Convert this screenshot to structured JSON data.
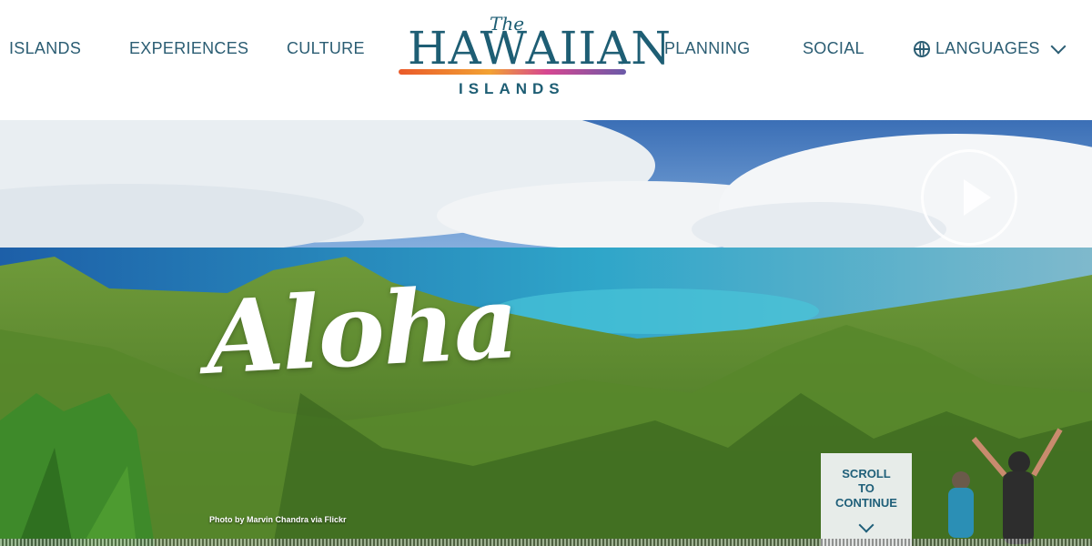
{
  "nav": {
    "left": [
      "ISLANDS",
      "EXPERIENCES",
      "CULTURE"
    ],
    "right": [
      "PLANNING",
      "SOCIAL"
    ],
    "languages_label": "LANGUAGES"
  },
  "logo": {
    "the": "The",
    "main": "HAWAIIAN",
    "sub": "ISLANDS",
    "tm": "™"
  },
  "hero": {
    "headline": "Aloha",
    "photo_credit": "Photo by Marvin Chandra via Flickr",
    "scroll_lines": [
      "SCROLL",
      "TO",
      "CONTINUE"
    ]
  },
  "icons": [
    "globe-icon",
    "chevron-down-icon",
    "play-icon"
  ],
  "colors": {
    "nav_text": "#2b5d73",
    "logo_blue": "#1e5e74",
    "accent_gradient": [
      "#ea5a2a",
      "#f2a233",
      "#d64791",
      "#6a5aa8"
    ]
  }
}
